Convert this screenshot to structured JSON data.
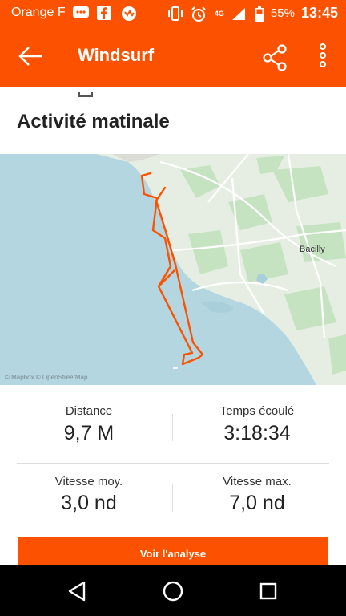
{
  "status_bar": {
    "carrier": "Orange F",
    "network": "4G",
    "battery": "55%",
    "time": "13:45",
    "icons": [
      "messages-icon",
      "facebook-icon",
      "sync-icon",
      "vibrate-icon",
      "alarm-icon",
      "signal-icon",
      "battery-icon"
    ]
  },
  "app_bar": {
    "title": "Windsurf",
    "icons": [
      "back-arrow-icon",
      "share-icon",
      "more-vert-icon"
    ]
  },
  "activity": {
    "title": "Activité matinale"
  },
  "map": {
    "place_label": "Bacilly",
    "attribution": "© Mapbox © OpenStreetMap",
    "colors": {
      "sea": "#b3d6e0",
      "land": "#e6eee3",
      "park": "#c6e3c1",
      "track": "#fc5200"
    }
  },
  "stats": {
    "distance": {
      "label": "Distance",
      "value": "9,7 M"
    },
    "elapsed": {
      "label": "Temps écoulé",
      "value": "3:18:34"
    },
    "avg_speed": {
      "label": "Vitesse moy.",
      "value": "3,0 nd"
    },
    "max_speed": {
      "label": "Vitesse max.",
      "value": "7,0 nd"
    }
  },
  "cta": {
    "label": "Voir l'analyse"
  },
  "colors": {
    "brand": "#fc5200"
  }
}
